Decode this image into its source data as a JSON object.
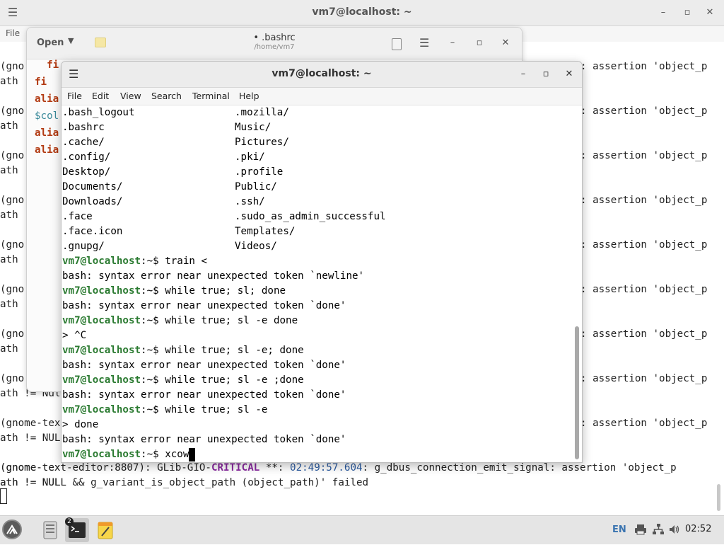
{
  "bg_terminal": {
    "title": "vm7@localhost: ~",
    "menu_file": "File",
    "lines": [
      "(gno",
      "ath",
      "",
      "(gno",
      "ath",
      "",
      "(gno",
      "ath",
      "",
      "(gno",
      "ath",
      "",
      "(gno",
      "ath",
      "",
      "(gno",
      "ath",
      "",
      "(gno",
      "ath",
      "",
      "(gno",
      "ath != Nul",
      "",
      "(gnome-tex",
      "ath != NUL",
      "",
      "(gnome-tex",
      "ath != NUL"
    ],
    "right_lines": [
      ": assertion 'object_p",
      ": assertion 'object_p",
      ": assertion 'object_p",
      ": assertion 'object_p",
      ": assertion 'object_p",
      ": assertion 'object_p",
      ": assertion 'object_p",
      ": assertion 'object_p",
      ": assertion 'object_p"
    ],
    "last_line_1_prefix": "(gnome-text-editor:8807): GLib-GIO-",
    "last_line_1_critical": "CRITICAL",
    "last_line_1_stars": " **: ",
    "last_line_1_time": "02:49:57.604",
    "last_line_1_rest": ": g_dbus_connection_emit_signal: assertion 'object_p",
    "last_line_2": "ath != NULL && g_variant_is_object_path (object_path)' failed"
  },
  "editor": {
    "open_label": "Open",
    "title": "• .bashrc",
    "subtitle": "/home/vm7",
    "code_lines": [
      {
        "text": "  fi",
        "cls": "kw-red"
      },
      {
        "text": "fi",
        "cls": "kw-red"
      },
      {
        "text": "alia",
        "cls": "kw-red"
      },
      {
        "text": "$col",
        "cls": "kw-teal"
      },
      {
        "text": "alia",
        "cls": "kw-red"
      },
      {
        "text": "alia",
        "cls": "kw-red"
      }
    ]
  },
  "terminal": {
    "title": "vm7@localhost: ~",
    "menu": [
      "File",
      "Edit",
      "View",
      "Search",
      "Terminal",
      "Help"
    ],
    "listing": [
      [
        ".bash_logout",
        ".mozilla/"
      ],
      [
        ".bashrc",
        "Music/"
      ],
      [
        ".cache/",
        "Pictures/"
      ],
      [
        ".config/",
        ".pki/"
      ],
      [
        "Desktop/",
        ".profile"
      ],
      [
        "Documents/",
        "Public/"
      ],
      [
        "Downloads/",
        ".ssh/"
      ],
      [
        ".face",
        ".sudo_as_admin_successful"
      ],
      [
        ".face.icon",
        "Templates/"
      ],
      [
        ".gnupg/",
        "Videos/"
      ]
    ],
    "prompt_user": "vm7@localhost",
    "prompt_rest": ":~$ ",
    "session": [
      {
        "type": "cmd",
        "text": "train <"
      },
      {
        "type": "out",
        "text": "bash: syntax error near unexpected token `newline'"
      },
      {
        "type": "cmd",
        "text": "while true; sl; done"
      },
      {
        "type": "out",
        "text": "bash: syntax error near unexpected token `done'"
      },
      {
        "type": "cmd",
        "text": "while true; sl -e done"
      },
      {
        "type": "out",
        "text": "> ^C"
      },
      {
        "type": "cmd",
        "text": "while true; sl -e; done"
      },
      {
        "type": "out",
        "text": "bash: syntax error near unexpected token `done'"
      },
      {
        "type": "cmd",
        "text": "while true; sl -e ;done"
      },
      {
        "type": "out",
        "text": "bash: syntax error near unexpected token `done'"
      },
      {
        "type": "cmd",
        "text": "while true; sl -e"
      },
      {
        "type": "out",
        "text": "> done"
      },
      {
        "type": "out",
        "text": "bash: syntax error near unexpected token `done'"
      },
      {
        "type": "cmd",
        "text": "xcow"
      }
    ]
  },
  "taskbar": {
    "terminal_badge": "2",
    "language": "EN",
    "clock": "02:52"
  }
}
